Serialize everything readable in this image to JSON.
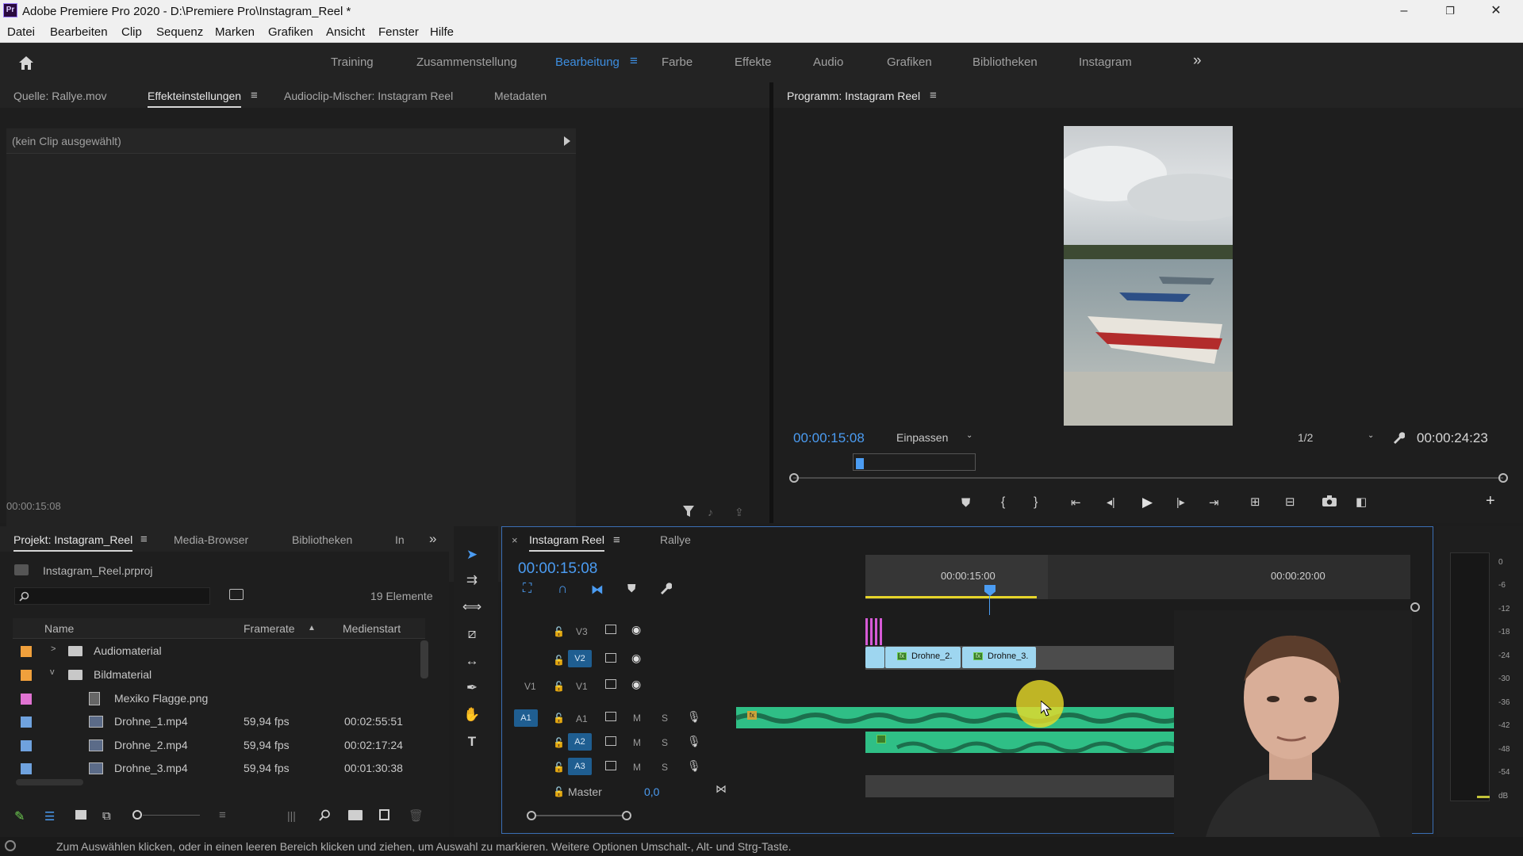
{
  "window": {
    "title": "Adobe Premiere Pro 2020 - D:\\Premiere Pro\\Instagram_Reel *",
    "app_icon": "Pr",
    "controls": {
      "minimize": "–",
      "maximize": "❐",
      "close": "✕"
    }
  },
  "menu": [
    "Datei",
    "Bearbeiten",
    "Clip",
    "Sequenz",
    "Marken",
    "Grafiken",
    "Ansicht",
    "Fenster",
    "Hilfe"
  ],
  "workspaces": {
    "items": [
      "Training",
      "Zusammenstellung",
      "Bearbeitung",
      "Farbe",
      "Effekte",
      "Audio",
      "Grafiken",
      "Bibliotheken",
      "Instagram"
    ],
    "active": "Bearbeitung",
    "overflow": "»",
    "menu_glyph": "≡"
  },
  "source_panel": {
    "tabs": [
      "Quelle: Rallye.mov",
      "Effekteinstellungen",
      "Audioclip-Mischer: Instagram Reel",
      "Metadaten"
    ],
    "active_tab": "Effekteinstellungen",
    "no_clip": "(kein Clip ausgewählt)",
    "timecode": "00:00:15:08"
  },
  "program_monitor": {
    "title": "Programm: Instagram Reel",
    "timecode": "00:00:15:08",
    "fit": "Einpassen",
    "resolution": "1/2",
    "duration": "00:00:24:23"
  },
  "project_panel": {
    "tabs": [
      "Projekt: Instagram_Reel",
      "Media-Browser",
      "Bibliotheken",
      "In"
    ],
    "file": "Instagram_Reel.prproj",
    "count": "19 Elemente",
    "columns": [
      "Name",
      "Framerate",
      "Medienstart"
    ],
    "rows": [
      {
        "name": "Audiomaterial",
        "type": "folder",
        "expanded": false,
        "color": "#f0a03c",
        "framerate": "",
        "start": ""
      },
      {
        "name": "Bildmaterial",
        "type": "folder",
        "expanded": true,
        "color": "#f0a03c",
        "framerate": "",
        "start": ""
      },
      {
        "name": "Mexiko Flagge.png",
        "type": "image",
        "color": "#e073d2",
        "framerate": "",
        "start": ""
      },
      {
        "name": "Drohne_1.mp4",
        "type": "video",
        "color": "#6fa2de",
        "framerate": "59,94 fps",
        "start": "00:02:55:51"
      },
      {
        "name": "Drohne_2.mp4",
        "type": "video",
        "color": "#6fa2de",
        "framerate": "59,94 fps",
        "start": "00:02:17:24"
      },
      {
        "name": "Drohne_3.mp4",
        "type": "video",
        "color": "#6fa2de",
        "framerate": "59,94 fps",
        "start": "00:01:30:38"
      }
    ]
  },
  "timeline": {
    "tabs": [
      "Instagram Reel",
      "Rallye"
    ],
    "active_tab": "Instagram Reel",
    "timecode": "00:00:15:08",
    "ruler": [
      "00:00:15:00",
      "00:00:20:00"
    ],
    "tracks": {
      "video": [
        "V3",
        "V2",
        "V1"
      ],
      "audio": [
        "A1",
        "A2",
        "A3"
      ],
      "v1_source": "V1",
      "a1_source": "A1",
      "master": "Master",
      "master_value": "0,0",
      "m": "M",
      "s": "S"
    },
    "clips": [
      "Drohne_2.",
      "Drohne_3."
    ]
  },
  "meter": {
    "labels": [
      "0",
      "-6",
      "-12",
      "-18",
      "-24",
      "-30",
      "-36",
      "-42",
      "-48",
      "-54",
      "dB"
    ]
  },
  "status": "Zum Auswählen klicken, oder in einen leeren Bereich klicken und ziehen, um Auswahl zu markieren. Weitere Optionen Umschalt-, Alt- und Strg-Taste."
}
